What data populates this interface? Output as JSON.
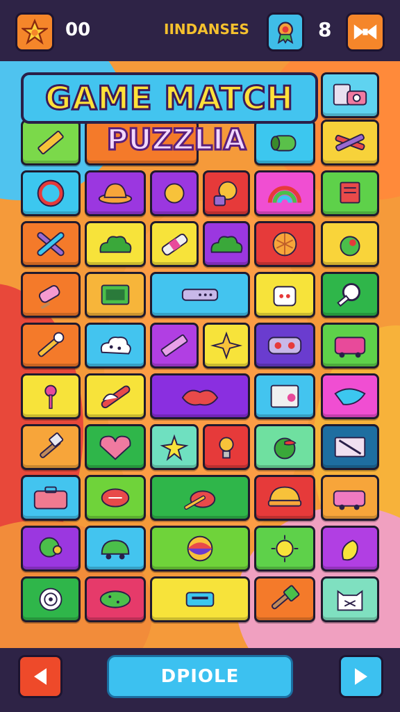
{
  "header": {
    "star_button_icon": "star-icon",
    "score": "00",
    "label": "IINDANSES",
    "badge_icon": "badge-icon",
    "level": "8",
    "menu_icon": "bowtie-icon",
    "colors": {
      "star_btn": "#f5862a",
      "badge_btn": "#3fbde8",
      "menu_btn": "#f5862a",
      "label": "#f5c12e"
    }
  },
  "title": {
    "main": "GAME MATCH",
    "sub": "PUZZLIA"
  },
  "tiles": [
    {
      "icon": "photos-icon",
      "color": "#5fd3f0",
      "glyph": "camera"
    },
    {
      "icon": "pencil-icon",
      "color": "#7bd94a",
      "glyph": "pencil"
    },
    {
      "icon": "",
      "color": "#f47a2a",
      "glyph": ""
    },
    {
      "icon": "log-icon",
      "color": "#3cc7ef",
      "glyph": "log"
    },
    {
      "icon": "tools-icon",
      "color": "#f7d23a",
      "glyph": "tools"
    },
    {
      "icon": "ring-icon",
      "color": "#3cc7ef",
      "glyph": "ring"
    },
    {
      "icon": "hat-icon",
      "color": "#9b37e0",
      "glyph": "hat"
    },
    {
      "icon": "lemon-icon",
      "color": "#9b37e0",
      "glyph": "dot"
    },
    {
      "icon": "lion-icon",
      "color": "#e63a3a",
      "glyph": "lion"
    },
    {
      "icon": "rainbow-icon",
      "color": "#f04ed2",
      "glyph": "rainbow"
    },
    {
      "icon": "note-icon",
      "color": "#5ed14a",
      "glyph": "note"
    },
    {
      "icon": "crossed-sticks-icon",
      "color": "#f47a2a",
      "glyph": "x"
    },
    {
      "icon": "bush-icon",
      "color": "#f7e33a",
      "glyph": "bush"
    },
    {
      "icon": "bottle-icon",
      "color": "#f7e33a",
      "glyph": "bottle"
    },
    {
      "icon": "cloud-icon",
      "color": "#9b37e0",
      "glyph": "bush"
    },
    {
      "icon": "pie-icon",
      "color": "#e63a3a",
      "glyph": "pie"
    },
    {
      "icon": "apple-icon",
      "color": "#f9d43a",
      "glyph": "apple"
    },
    {
      "icon": "popsicle-icon",
      "color": "#f47a2a",
      "glyph": "popsicle"
    },
    {
      "icon": "radio-icon",
      "color": "#f7b53a",
      "glyph": "radio"
    },
    {
      "icon": "flute-icon",
      "color": "#43c4ef",
      "glyph": "flute"
    },
    {
      "icon": "toaster-icon",
      "color": "#f7e33a",
      "glyph": "toaster"
    },
    {
      "icon": "magnifier-icon",
      "color": "#2fb64a",
      "glyph": "magnifier"
    },
    {
      "icon": "brush-icon",
      "color": "#f47a2a",
      "glyph": "brush"
    },
    {
      "icon": "dice-cloud-icon",
      "color": "#43c4ef",
      "glyph": "cloud"
    },
    {
      "icon": "crayon-icon",
      "color": "#b13fe3",
      "glyph": "crayon"
    },
    {
      "icon": "star-shape-icon",
      "color": "#f7e33a",
      "glyph": "star4"
    },
    {
      "icon": "gamepad-icon",
      "color": "#6a3ccf",
      "glyph": "gamepad"
    },
    {
      "icon": "bus-icon",
      "color": "#5ed14a",
      "glyph": "bus"
    },
    {
      "icon": "pin-icon",
      "color": "#f7e33a",
      "glyph": "pin"
    },
    {
      "icon": "rolling-pin-icon",
      "color": "#f7e33a",
      "glyph": "rollpin"
    },
    {
      "icon": "lips-icon",
      "color": "#8a2fe0",
      "glyph": "lips"
    },
    {
      "icon": "calculator-icon",
      "color": "#43c4ef",
      "glyph": "calc"
    },
    {
      "icon": "bird-icon",
      "color": "#f04ed2",
      "glyph": "bird"
    },
    {
      "icon": "hammer-icon",
      "color": "#f7a53a",
      "glyph": "hammer"
    },
    {
      "icon": "heart-icon",
      "color": "#2fb64a",
      "glyph": "heart"
    },
    {
      "icon": "sparkle-icon",
      "color": "#6fe0c0",
      "glyph": "sparkle"
    },
    {
      "icon": "bulb-icon",
      "color": "#e63a3a",
      "glyph": "bulb"
    },
    {
      "icon": "leaf-icon",
      "color": "#6fe0a0",
      "glyph": "leaf"
    },
    {
      "icon": "card-icon",
      "color": "#1e6ea0",
      "glyph": "card"
    },
    {
      "icon": "suitcase-icon",
      "color": "#43c4ef",
      "glyph": "case"
    },
    {
      "icon": "football-icon",
      "color": "#6fd33a",
      "glyph": "football"
    },
    {
      "icon": "paint-icon",
      "color": "#2fb64a",
      "glyph": "paint"
    },
    {
      "icon": "burger-icon",
      "color": "#e63a3a",
      "glyph": "burger"
    },
    {
      "icon": "van-icon",
      "color": "#f7a53a",
      "glyph": "van"
    },
    {
      "icon": "chat-icon",
      "color": "#9b37e0",
      "glyph": "chat"
    },
    {
      "icon": "turtle-icon",
      "color": "#43c4ef",
      "glyph": "turtle"
    },
    {
      "icon": "ball-icon",
      "color": "#6fd33a",
      "glyph": "ball"
    },
    {
      "icon": "sun-icon",
      "color": "#5ed14a",
      "glyph": "sun"
    },
    {
      "icon": "pepper-icon",
      "color": "#b13fe3",
      "glyph": "pepper"
    },
    {
      "icon": "shell-icon",
      "color": "#2fb64a",
      "glyph": "shell"
    },
    {
      "icon": "pickle-icon",
      "color": "#e63a6a",
      "glyph": "pickle"
    },
    {
      "icon": "projector-icon",
      "color": "#f7e33a",
      "glyph": "projector"
    },
    {
      "icon": "stamp-icon",
      "color": "#f47a2a",
      "glyph": "stamp"
    },
    {
      "icon": "cat-icon",
      "color": "#7fe0c0",
      "glyph": "cat"
    }
  ],
  "footer": {
    "prev_icon": "left-arrow-icon",
    "button_label": "DPIOLE",
    "next_icon": "right-arrow-icon",
    "colors": {
      "prev_btn": "#ee4a2a",
      "main_btn": "#3cc1f0",
      "next_btn": "#3cc1f0"
    }
  }
}
